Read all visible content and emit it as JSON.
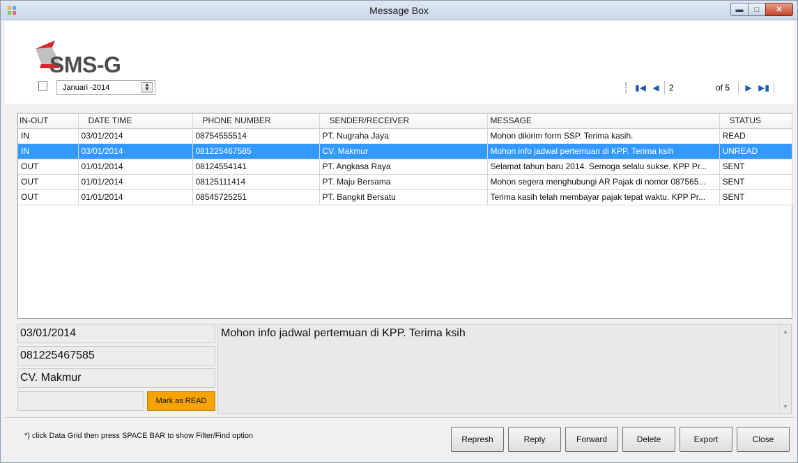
{
  "window": {
    "title": "Message Box"
  },
  "logo": {
    "text": "SMS-G"
  },
  "filter": {
    "date_value": "Januari  -2014"
  },
  "pager": {
    "current_page": "2",
    "of_label": "of 5"
  },
  "grid": {
    "columns": [
      "IN-OUT",
      "DATE TIME",
      "PHONE NUMBER",
      "SENDER/RECEIVER",
      "MESSAGE",
      "STATUS"
    ],
    "rows": [
      [
        "IN",
        "03/01/2014",
        "08754555514",
        "PT. Nugraha Jaya",
        "Mohon dikirim form SSP. Terima kasih.",
        "READ"
      ],
      [
        "IN",
        "03/01/2014",
        "081225467585",
        "CV. Makmur",
        "Mohon info jadwal pertemuan di KPP. Terima ksih",
        "UNREAD"
      ],
      [
        "OUT",
        "01/01/2014",
        "08124554141",
        "PT. Angkasa Raya",
        "Selamat tahun baru 2014. Semoga selalu sukse. KPP Pr...",
        "SENT"
      ],
      [
        "OUT",
        "01/01/2014",
        "08125111414",
        "PT. Maju Bersama",
        "Mohon segera menghubungi AR Pajak di nomor 087565...",
        "SENT"
      ],
      [
        "OUT",
        "01/01/2014",
        "08545725251",
        "PT. Bangkit Bersatu",
        "Terima kasih telah membayar pajak tepat waktu. KPP Pr...",
        "SENT"
      ]
    ],
    "selected_row": 1
  },
  "detail": {
    "date": "03/01/2014",
    "phone": "081225467585",
    "name": "CV. Makmur",
    "mark_label": "Mark as READ",
    "message": "Mohon info jadwal pertemuan di KPP. Terima ksih"
  },
  "footer": {
    "hint": "*) click Data Grid then  press SPACE BAR to show Filter/Find option",
    "buttons": {
      "refresh": "Represh",
      "reply": "Reply",
      "forward": "Forward",
      "delete": "Delete",
      "export": "Export",
      "close": "Close"
    }
  },
  "colors": {
    "selection": "#3399ff",
    "mark_button": "#f5a300",
    "logo_red": "#d8262e"
  },
  "icons": {
    "app": "app-icon",
    "minimize": "minimize-icon",
    "maximize": "maximize-icon",
    "close": "close-icon"
  }
}
